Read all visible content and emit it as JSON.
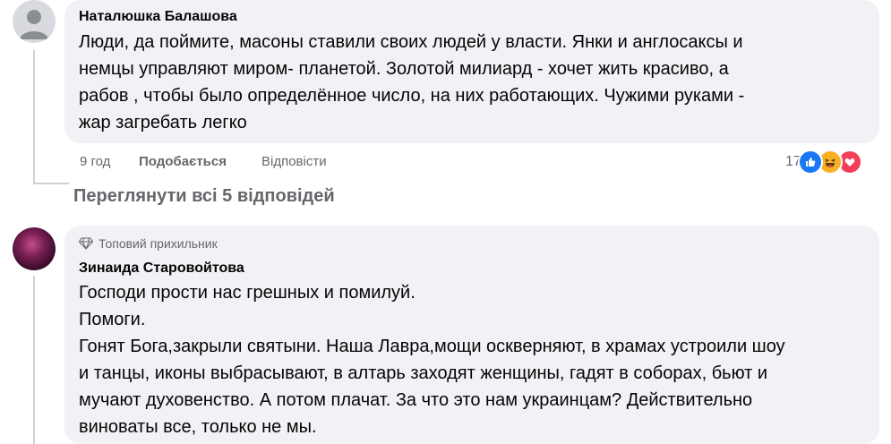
{
  "comment1": {
    "author": "Наталюшка Балашова",
    "lines": [
      "Люди, да поймите, масоны ставили своих людей у власти. Янки и англосаксы и",
      "немцы управляют миром- планетой. Золотой милиард - хочет жить красиво, а",
      "рабов , чтобы было определённое число, на них работающих. Чужими руками -",
      "жар загребать легко"
    ],
    "time": "9 год",
    "like_label": "Подобається",
    "reply_label": "Відповісти",
    "reaction_count": "17",
    "reactions": [
      "like-icon",
      "haha-icon",
      "love-icon"
    ],
    "view_replies": "Переглянути всі 5 відповідей"
  },
  "comment2": {
    "badge": "Топовий прихильник",
    "author": "Зинаида Старовойтова",
    "lines": [
      "Господи прости нас грешных и помилуй.",
      "Помоги.",
      "Гонят Бога,закрыли святыни. Наша Лавра,мощи оскверняют, в храмах устроили шоу",
      "и танцы, иконы выбрасывают, в алтарь заходят женщины, гадят в соборах, бьют и",
      "мучают духовенство. А потом плачат. За что это нам украинцам? Действительно",
      "виноваты все, только не мы."
    ]
  },
  "colors": {
    "bubble": "#f0f2f5",
    "meta_text": "#65676b",
    "like": "#1877f2",
    "haha": "#f7b125",
    "love": "#f33e58"
  }
}
